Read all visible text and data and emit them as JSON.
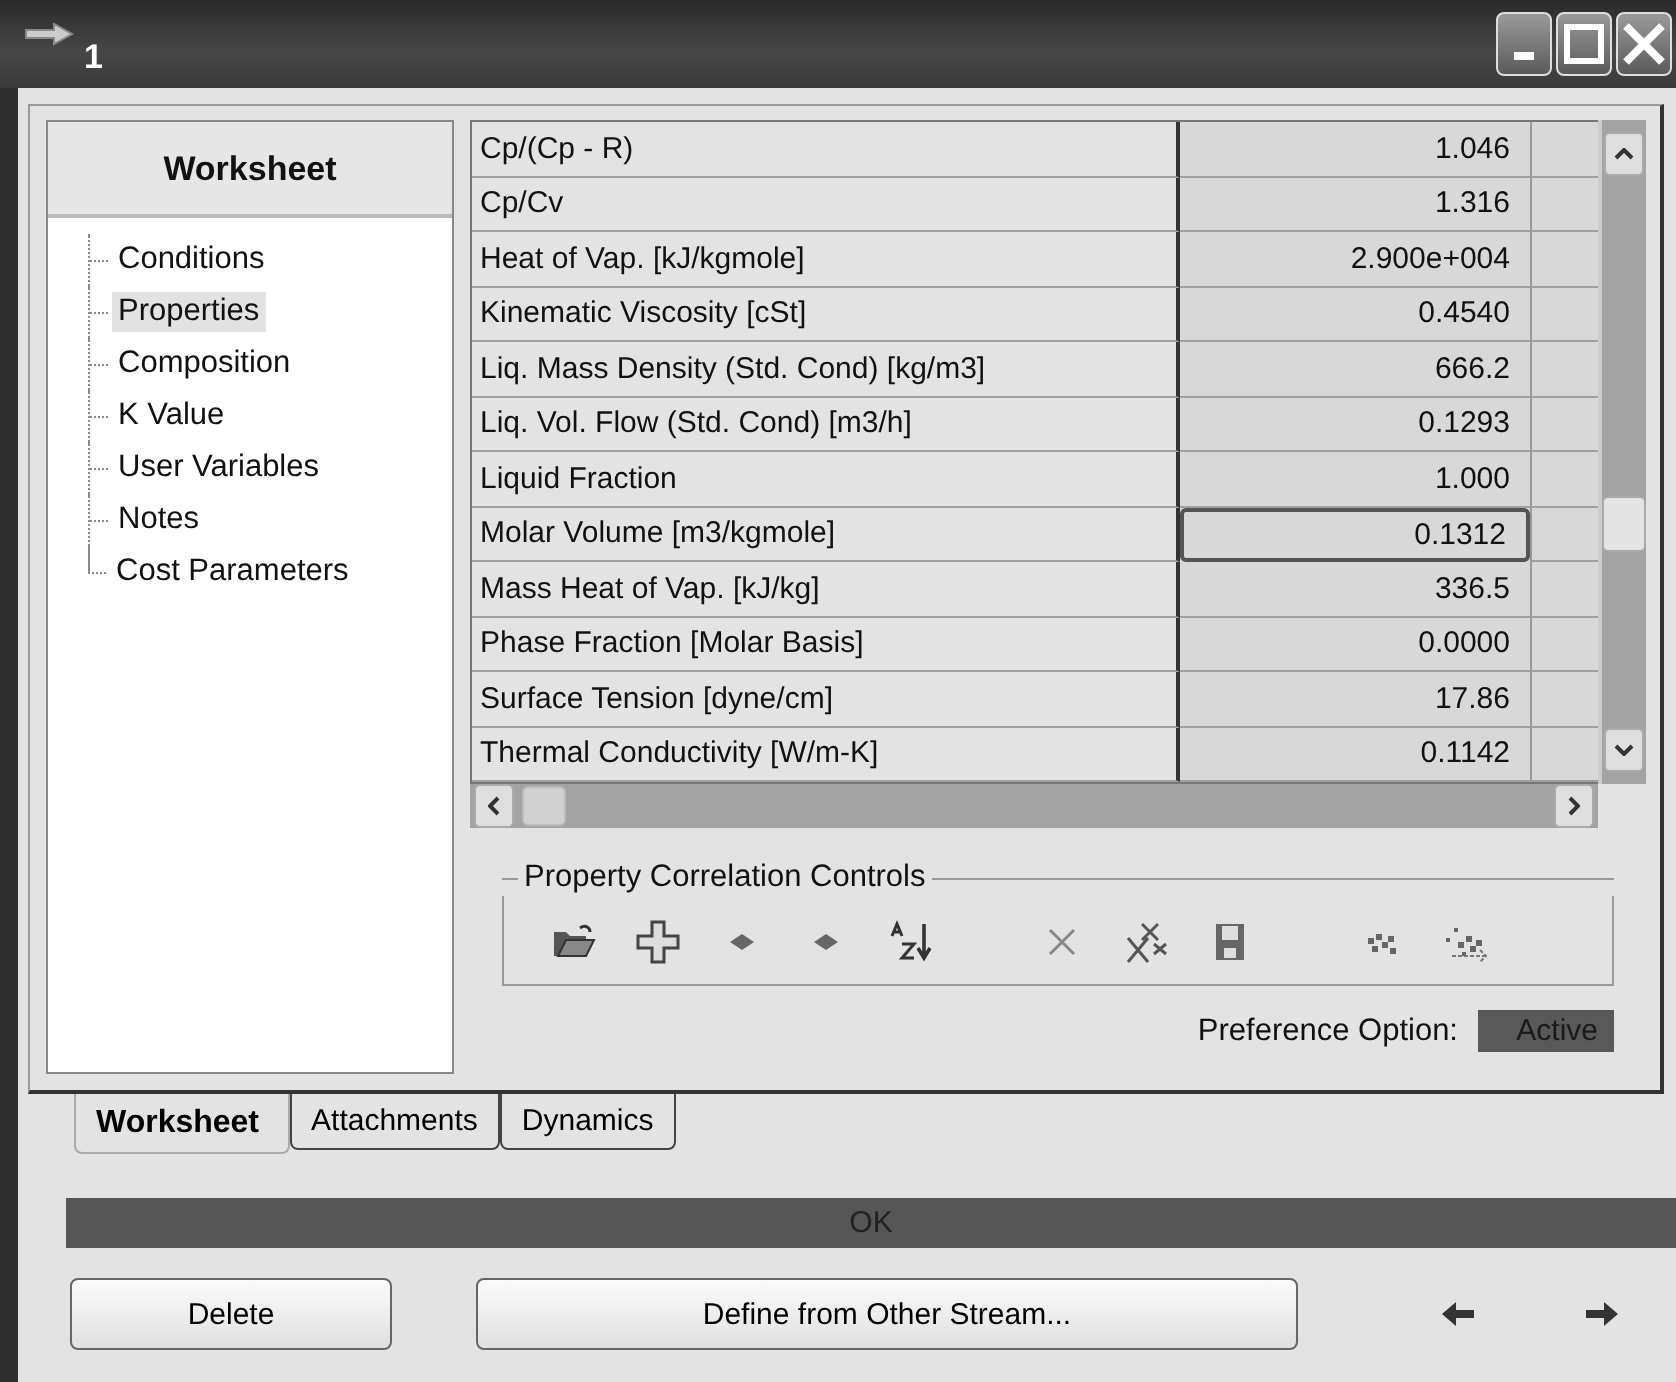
{
  "window": {
    "title": "1"
  },
  "navigator": {
    "header": "Worksheet",
    "items": [
      {
        "label": "Conditions",
        "selected": false
      },
      {
        "label": "Properties",
        "selected": true
      },
      {
        "label": "Composition",
        "selected": false
      },
      {
        "label": "K Value",
        "selected": false
      },
      {
        "label": "User Variables",
        "selected": false
      },
      {
        "label": "Notes",
        "selected": false
      },
      {
        "label": "Cost Parameters",
        "selected": false
      }
    ]
  },
  "table": {
    "rows": [
      {
        "property": "Cp/(Cp - R)",
        "value": "1.046",
        "focused": false
      },
      {
        "property": "Cp/Cv",
        "value": "1.316",
        "focused": false
      },
      {
        "property": "Heat of Vap. [kJ/kgmole]",
        "value": "2.900e+004",
        "focused": false
      },
      {
        "property": "Kinematic Viscosity [cSt]",
        "value": "0.4540",
        "focused": false
      },
      {
        "property": "Liq. Mass Density (Std. Cond) [kg/m3]",
        "value": "666.2",
        "focused": false
      },
      {
        "property": "Liq. Vol. Flow (Std. Cond) [m3/h]",
        "value": "0.1293",
        "focused": false
      },
      {
        "property": "Liquid Fraction",
        "value": "1.000",
        "focused": false
      },
      {
        "property": "Molar Volume [m3/kgmole]",
        "value": "0.1312",
        "focused": true
      },
      {
        "property": "Mass Heat of Vap. [kJ/kg]",
        "value": "336.5",
        "focused": false
      },
      {
        "property": "Phase Fraction [Molar Basis]",
        "value": "0.0000",
        "focused": false
      },
      {
        "property": "Surface Tension [dyne/cm]",
        "value": "17.86",
        "focused": false
      },
      {
        "property": "Thermal Conductivity [W/m-K]",
        "value": "0.1142",
        "focused": false
      }
    ]
  },
  "correlation_controls": {
    "title": "Property Correlation Controls",
    "tool_groups": [
      [
        {
          "kind": "open"
        },
        {
          "kind": "add"
        },
        {
          "kind": "down"
        },
        {
          "kind": "up"
        },
        {
          "kind": "sort"
        }
      ],
      [
        {
          "kind": "delete"
        },
        {
          "kind": "delete-all"
        },
        {
          "kind": "save"
        }
      ],
      [
        {
          "kind": "plot"
        },
        {
          "kind": "plot-all"
        }
      ]
    ]
  },
  "preference": {
    "label": "Preference Option:",
    "value": "Active"
  },
  "tabs": [
    {
      "label": "Worksheet",
      "selected": true
    },
    {
      "label": "Attachments",
      "selected": false
    },
    {
      "label": "Dynamics",
      "selected": false
    }
  ],
  "status_bar": {
    "text": "OK"
  },
  "buttons": [
    {
      "label": "Delete"
    },
    {
      "label": "Define from Other Stream..."
    }
  ],
  "navigation_arrows": [
    {
      "kind": "back"
    },
    {
      "kind": "forward"
    }
  ]
}
